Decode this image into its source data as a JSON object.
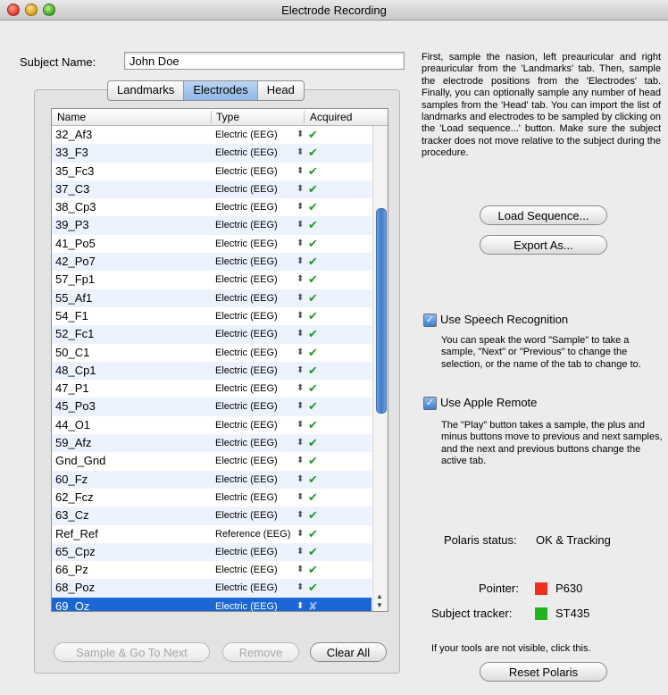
{
  "window": {
    "title": "Electrode Recording"
  },
  "subject": {
    "label": "Subject Name:",
    "value": "John Doe"
  },
  "tabs": [
    "Landmarks",
    "Electrodes",
    "Head"
  ],
  "active_tab": "Electrodes",
  "table": {
    "columns": [
      "Name",
      "Type",
      "Acquired"
    ],
    "rows": [
      {
        "name": "32_Af3",
        "type": "Electric (EEG)",
        "acquired": true
      },
      {
        "name": "33_F3",
        "type": "Electric (EEG)",
        "acquired": true
      },
      {
        "name": "35_Fc3",
        "type": "Electric (EEG)",
        "acquired": true
      },
      {
        "name": "37_C3",
        "type": "Electric (EEG)",
        "acquired": true
      },
      {
        "name": "38_Cp3",
        "type": "Electric (EEG)",
        "acquired": true
      },
      {
        "name": "39_P3",
        "type": "Electric (EEG)",
        "acquired": true
      },
      {
        "name": "41_Po5",
        "type": "Electric (EEG)",
        "acquired": true
      },
      {
        "name": "42_Po7",
        "type": "Electric (EEG)",
        "acquired": true
      },
      {
        "name": "57_Fp1",
        "type": "Electric (EEG)",
        "acquired": true
      },
      {
        "name": "55_Af1",
        "type": "Electric (EEG)",
        "acquired": true
      },
      {
        "name": "54_F1",
        "type": "Electric (EEG)",
        "acquired": true
      },
      {
        "name": "52_Fc1",
        "type": "Electric (EEG)",
        "acquired": true
      },
      {
        "name": "50_C1",
        "type": "Electric (EEG)",
        "acquired": true
      },
      {
        "name": "48_Cp1",
        "type": "Electric (EEG)",
        "acquired": true
      },
      {
        "name": "47_P1",
        "type": "Electric (EEG)",
        "acquired": true
      },
      {
        "name": "45_Po3",
        "type": "Electric (EEG)",
        "acquired": true
      },
      {
        "name": "44_O1",
        "type": "Electric (EEG)",
        "acquired": true
      },
      {
        "name": "59_Afz",
        "type": "Electric (EEG)",
        "acquired": true
      },
      {
        "name": "Gnd_Gnd",
        "type": "Electric (EEG)",
        "acquired": true
      },
      {
        "name": "60_Fz",
        "type": "Electric (EEG)",
        "acquired": true
      },
      {
        "name": "62_Fcz",
        "type": "Electric (EEG)",
        "acquired": true
      },
      {
        "name": "63_Cz",
        "type": "Electric (EEG)",
        "acquired": true
      },
      {
        "name": "Ref_Ref",
        "type": "Reference (EEG)",
        "acquired": true
      },
      {
        "name": "65_Cpz",
        "type": "Electric (EEG)",
        "acquired": true
      },
      {
        "name": "66_Pz",
        "type": "Electric (EEG)",
        "acquired": true
      },
      {
        "name": "68_Poz",
        "type": "Electric (EEG)",
        "acquired": true
      },
      {
        "name": "69_Oz",
        "type": "Electric (EEG)",
        "acquired": false
      }
    ],
    "selected_row": "69_Oz",
    "check_mark": "✔",
    "cross_mark": "✘",
    "stepper_glyph": "⬍"
  },
  "buttons": {
    "sample_next": "Sample & Go To Next",
    "remove": "Remove",
    "clear_all": "Clear All",
    "load_sequence": "Load Sequence...",
    "export_as": "Export As...",
    "reset_polaris": "Reset Polaris"
  },
  "instructions": "First, sample the nasion, left preauricular and right preauricular from the 'Landmarks' tab. Then, sample the electrode positions from the 'Electrodes' tab. Finally, you can optionally sample any number of head samples from the 'Head' tab. You can import the list of landmarks and electrodes to be sampled by clicking on the 'Load sequence...' button. Make sure the subject tracker does not move relative to the subject during the procedure.",
  "speech": {
    "label": "Use Speech Recognition",
    "checked": true,
    "description": "You can speak the word \"Sample\" to take a sample, \"Next\" or \"Previous\" to change the selection, or the name of the tab to change to."
  },
  "remote": {
    "label": "Use Apple Remote",
    "checked": true,
    "description": "The \"Play\" button takes a sample, the plus and minus buttons move to previous and next samples, and the next and previous buttons change the active tab."
  },
  "polaris": {
    "label": "Polaris status:",
    "value": "OK & Tracking"
  },
  "pointer": {
    "label": "Pointer:",
    "value": "P630",
    "color": "#f0301e"
  },
  "tracker": {
    "label": "Subject tracker:",
    "value": "ST435",
    "color": "#1fb51f"
  },
  "hint": "If your tools are not visible, click this.",
  "checkbox_mark": "✓"
}
